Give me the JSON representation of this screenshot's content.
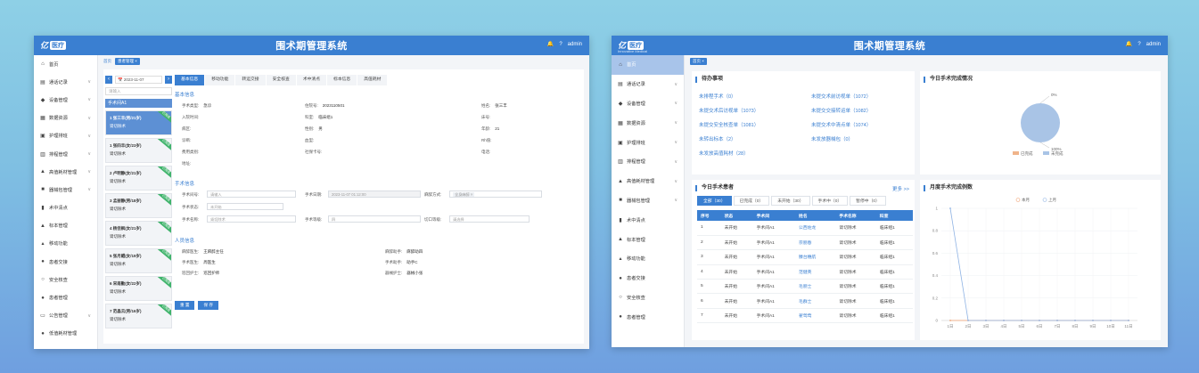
{
  "app_title": "围术期管理系统",
  "logo": {
    "text": "亿",
    "tag": "医疗",
    "sub": "Innovative Medical"
  },
  "topbar": {
    "bell": "🔔",
    "help": "?",
    "user": "admin"
  },
  "sidebar_left": [
    {
      "icon": "⌂",
      "label": "首页",
      "arrow": ""
    },
    {
      "icon": "▤",
      "label": "通话记录",
      "arrow": "∨"
    },
    {
      "icon": "◆",
      "label": "设备管理",
      "arrow": "∨"
    },
    {
      "icon": "▦",
      "label": "数据资源",
      "arrow": "∨"
    },
    {
      "icon": "▣",
      "label": "护理排班",
      "arrow": "∨"
    },
    {
      "icon": "▥",
      "label": "排程管理",
      "arrow": "∨"
    },
    {
      "icon": "▲",
      "label": "高值耗材管理",
      "arrow": "∨"
    },
    {
      "icon": "■",
      "label": "器械包管理",
      "arrow": "∨"
    },
    {
      "icon": "▮",
      "label": "术中清点",
      "arrow": ""
    },
    {
      "icon": "▲",
      "label": "标本管理",
      "arrow": ""
    },
    {
      "icon": "▴",
      "label": "移动功能",
      "arrow": ""
    },
    {
      "icon": "●",
      "label": "患者交接",
      "arrow": ""
    },
    {
      "icon": "○",
      "label": "安全核查",
      "arrow": ""
    },
    {
      "icon": "●",
      "label": "患者管理",
      "arrow": ""
    },
    {
      "icon": "▭",
      "label": "公告管理",
      "arrow": "∨"
    },
    {
      "icon": "●",
      "label": "低值耗材管理",
      "arrow": ""
    }
  ],
  "sidebar_right": [
    {
      "icon": "⌂",
      "label": "首页",
      "arrow": ""
    },
    {
      "icon": "▤",
      "label": "通话记录",
      "arrow": "∨"
    },
    {
      "icon": "◆",
      "label": "设备管理",
      "arrow": "∨"
    },
    {
      "icon": "▦",
      "label": "数据资源",
      "arrow": "∨"
    },
    {
      "icon": "▣",
      "label": "护理排班",
      "arrow": "∨"
    },
    {
      "icon": "▥",
      "label": "排程管理",
      "arrow": "∨"
    },
    {
      "icon": "▲",
      "label": "高值耗材管理",
      "arrow": "∨"
    },
    {
      "icon": "■",
      "label": "器械包管理",
      "arrow": "∨"
    },
    {
      "icon": "▮",
      "label": "术中清点",
      "arrow": ""
    },
    {
      "icon": "▲",
      "label": "标本管理",
      "arrow": ""
    },
    {
      "icon": "▴",
      "label": "移动功能",
      "arrow": ""
    },
    {
      "icon": "●",
      "label": "患者交接",
      "arrow": ""
    },
    {
      "icon": "○",
      "label": "安全核查",
      "arrow": ""
    },
    {
      "icon": "●",
      "label": "患者管理",
      "arrow": ""
    }
  ],
  "w1": {
    "crumbs": [
      "首页",
      "患者管理 ×"
    ],
    "date": "2023-11-07",
    "search_placeholder": "请输入",
    "room": "手术间A1",
    "patients": [
      {
        "no": "1",
        "name": "张三丰(男/21岁)",
        "op": "肾切除术",
        "flag": "已完成",
        "active": true
      },
      {
        "no": "1",
        "name": "张四丰(女/23岁)",
        "op": "肾切除术",
        "flag": "已完成",
        "active": false
      },
      {
        "no": "2",
        "name": "卢明静(女/21岁)",
        "op": "肾切除术",
        "flag": "已完成",
        "active": false
      },
      {
        "no": "3",
        "name": "孟丽静(男/18岁)",
        "op": "肾切除术",
        "flag": "已完成",
        "active": false
      },
      {
        "no": "4",
        "name": "杨佳枫(女/21岁)",
        "op": "肾切除术",
        "flag": "已完成",
        "active": false
      },
      {
        "no": "5",
        "name": "张月鲲(女/19岁)",
        "op": "肾切除术",
        "flag": "已完成",
        "active": false
      },
      {
        "no": "6",
        "name": "宋南勤(女/22岁)",
        "op": "肾切除术",
        "flag": "已完成",
        "active": false
      },
      {
        "no": "7",
        "name": "范晶云(男/16岁)",
        "op": "肾切除术",
        "flag": "已完成",
        "active": false
      }
    ],
    "tabs": [
      "基本信息",
      "移动功能",
      "转运交接",
      "安全核查",
      "术中清点",
      "标本信息",
      "高值耗材"
    ],
    "basic_title": "基本信息",
    "basic": [
      {
        "k": "手术类型:",
        "v": "急诊"
      },
      {
        "k": "住院号:",
        "v": "2023110501"
      },
      {
        "k": "姓名:",
        "v": "张三丰"
      },
      {
        "k": "入院时间:",
        "v": ""
      },
      {
        "k": "科室:",
        "v": "临床组1"
      },
      {
        "k": "床号:",
        "v": ""
      },
      {
        "k": "病区:",
        "v": ""
      },
      {
        "k": "性别:",
        "v": "男"
      },
      {
        "k": "年龄:",
        "v": "21"
      },
      {
        "k": "诊断:",
        "v": ""
      },
      {
        "k": "血型:",
        "v": ""
      },
      {
        "k": "Rh值:",
        "v": ""
      },
      {
        "k": "费用类别:",
        "v": ""
      },
      {
        "k": "社保卡号:",
        "v": ""
      },
      {
        "k": "电话:",
        "v": ""
      },
      {
        "k": "地址:",
        "v": ""
      }
    ],
    "surgery_title": "手术信息",
    "surgery": {
      "room_label": "手术间号:",
      "room_val": "请输入",
      "date_label": "手术日期:",
      "date_val": "2023-11-07 01:12:00",
      "anes_label": "麻醉方式:",
      "anes_val": "全身麻醉 ×",
      "status_label": "手术状态:",
      "status_val": "未开始",
      "name_label": "手术名称:",
      "name_val": "肾切除术",
      "level_label": "手术等级:",
      "level_val": "四",
      "cut_label": "切口等级:",
      "cut_val": "请选择"
    },
    "staff_title": "人员信息",
    "staff": [
      {
        "k": "麻醉医生:",
        "v": "王麻醉主任"
      },
      {
        "k": "麻醉助手:",
        "v": "麻醉助四"
      },
      {
        "k": "手术医生:",
        "v": "周医生"
      },
      {
        "k": "手术助手:",
        "v": "助手C"
      },
      {
        "k": "巡回护士:",
        "v": "巡回护师"
      },
      {
        "k": "器械护士:",
        "v": "器械小张"
      }
    ],
    "btn_reset": "重 置",
    "btn_save": "保 存"
  },
  "w2": {
    "crumbs": [
      "首页 ×"
    ],
    "todo_title": "待办事项",
    "todo_left": [
      "未排程手术（0）",
      "未提交术后访视单（1073）",
      "未提交安全核查单（1081）",
      "未转出标本（2）",
      "未发放高值耗材（28）"
    ],
    "todo_right": [
      "未提交术前访视单（1072）",
      "未提交交接转运单（1082）",
      "未提交术中清点单（1074）",
      "未发放器械包（0）"
    ],
    "pie_title": "今日手术完成情况",
    "pie_legend": [
      "已完成",
      "未完成"
    ],
    "pie_top_label": "0%",
    "pie_bottom_label": "100%",
    "patients_title": "今日手术患者",
    "more": "更多 >>",
    "filters": [
      "全部（30）",
      "已完成（0）",
      "未开始（30）",
      "手术中（0）",
      "暂停中（0）"
    ],
    "table_headers": [
      "序号",
      "状态",
      "手术间",
      "姓名",
      "手术名称",
      "科室"
    ],
    "table_rows": [
      [
        "1",
        "未开始",
        "手术间A1",
        "公西佐龙",
        "肾切除术",
        "临床组1"
      ],
      [
        "2",
        "未开始",
        "手术间A1",
        "宗丽春",
        "肾切除术",
        "临床组1"
      ],
      [
        "3",
        "未开始",
        "手术间A1",
        "滕台穗航",
        "肾切除术",
        "临床组1"
      ],
      [
        "4",
        "未开始",
        "手术间A1",
        "范健英",
        "肾切除术",
        "临床组1"
      ],
      [
        "5",
        "未开始",
        "手术间A1",
        "毛丽士",
        "肾切除术",
        "临床组1"
      ],
      [
        "6",
        "未开始",
        "手术间A1",
        "毛群士",
        "肾切除术",
        "临床组1"
      ],
      [
        "7",
        "未开始",
        "手术间A1",
        "翟莺莺",
        "肾切除术",
        "临床组1"
      ]
    ],
    "line_title": "月度手术完成例数"
  },
  "chart_data": [
    {
      "type": "pie",
      "title": "今日手术完成情况",
      "labels": [
        "已完成",
        "未完成"
      ],
      "values": [
        0,
        100
      ],
      "colors": [
        "#f0b48a",
        "#a9c4e6"
      ]
    },
    {
      "type": "line",
      "title": "月度手术完成例数",
      "x": [
        "1日",
        "2日",
        "3日",
        "4日",
        "5日",
        "6日",
        "7日",
        "8日",
        "9日",
        "10日",
        "11日"
      ],
      "ylim": [
        0,
        1
      ],
      "yticks": [
        "0",
        "0.2",
        "0.4",
        "0.6",
        "0.8",
        "1"
      ],
      "series": [
        {
          "name": "本月",
          "color": "#f0a070",
          "values": [
            0,
            0,
            0,
            0,
            0,
            0,
            0,
            0,
            0,
            0,
            0
          ]
        },
        {
          "name": "上月",
          "color": "#8fb3e4",
          "values": [
            1,
            0,
            0,
            0,
            0,
            0,
            0,
            0,
            0,
            0,
            0
          ]
        }
      ]
    }
  ]
}
